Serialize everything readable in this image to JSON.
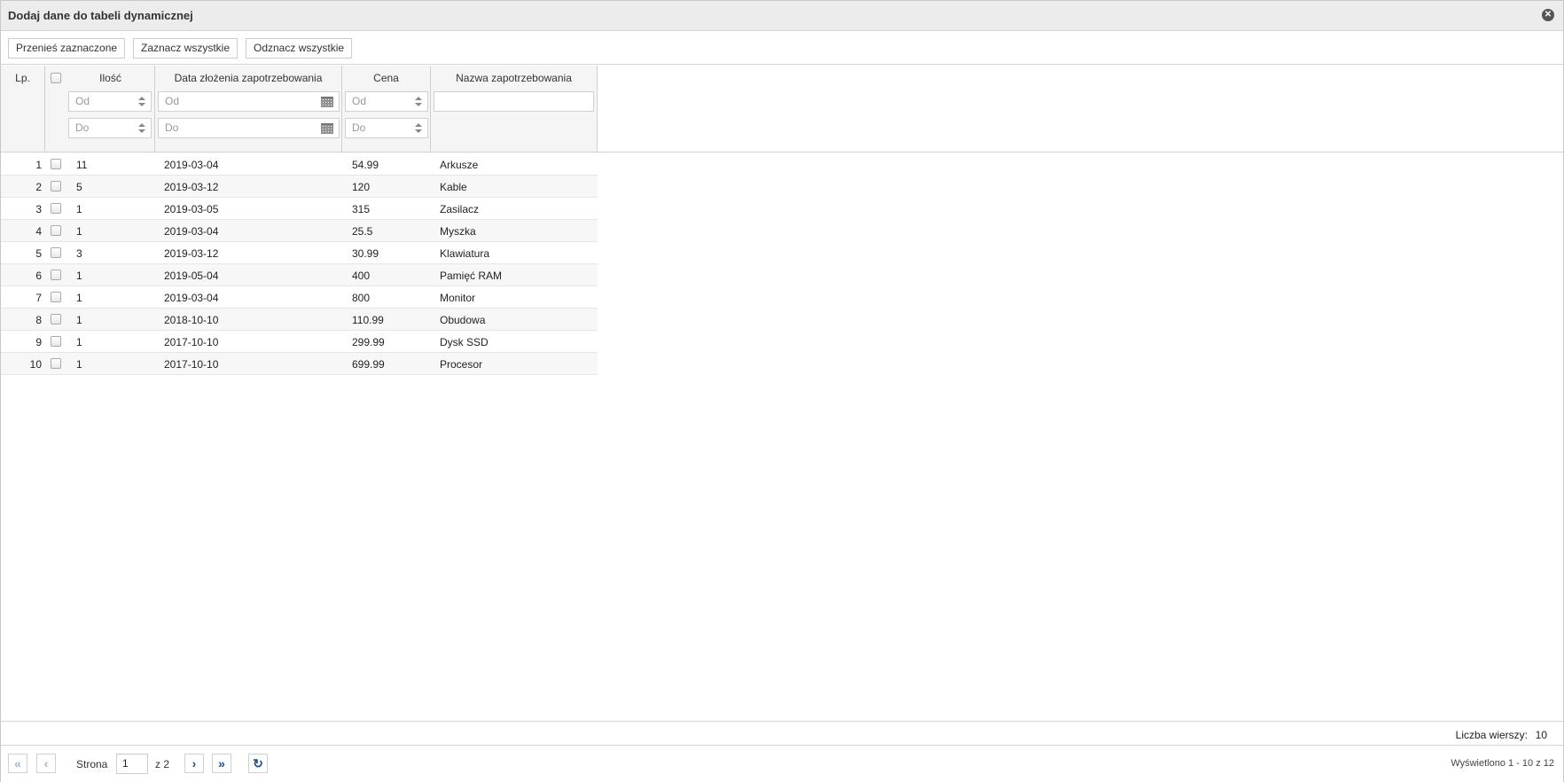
{
  "dialog": {
    "title": "Dodaj dane do tabeli dynamicznej",
    "close_icon": "close-circle-icon"
  },
  "toolbar": {
    "move_selected": "Przenieś zaznaczone",
    "select_all": "Zaznacz wszystkie",
    "deselect_all": "Odznacz wszystkie"
  },
  "columns": {
    "lp": "Lp.",
    "qty": "Ilość",
    "date": "Data złożenia zapotrzebowania",
    "price": "Cena",
    "name": "Nazwa zapotrzebowania"
  },
  "filters": {
    "qty_from": "Od",
    "qty_to": "Do",
    "date_from": "Od",
    "date_to": "Do",
    "price_from": "Od",
    "price_to": "Do",
    "name": ""
  },
  "rows": [
    {
      "lp": "1",
      "qty": "11",
      "date": "2019-03-04",
      "price": "54.99",
      "name": "Arkusze"
    },
    {
      "lp": "2",
      "qty": "5",
      "date": "2019-03-12",
      "price": "120",
      "name": "Kable"
    },
    {
      "lp": "3",
      "qty": "1",
      "date": "2019-03-05",
      "price": "315",
      "name": "Zasilacz"
    },
    {
      "lp": "4",
      "qty": "1",
      "date": "2019-03-04",
      "price": "25.5",
      "name": "Myszka"
    },
    {
      "lp": "5",
      "qty": "3",
      "date": "2019-03-12",
      "price": "30.99",
      "name": "Klawiatura"
    },
    {
      "lp": "6",
      "qty": "1",
      "date": "2019-05-04",
      "price": "400",
      "name": "Pamięć RAM"
    },
    {
      "lp": "7",
      "qty": "1",
      "date": "2019-03-04",
      "price": "800",
      "name": "Monitor"
    },
    {
      "lp": "8",
      "qty": "1",
      "date": "2018-10-10",
      "price": "110.99",
      "name": "Obudowa"
    },
    {
      "lp": "9",
      "qty": "1",
      "date": "2017-10-10",
      "price": "299.99",
      "name": "Dysk SSD"
    },
    {
      "lp": "10",
      "qty": "1",
      "date": "2017-10-10",
      "price": "699.99",
      "name": "Procesor"
    }
  ],
  "footer": {
    "rows_label": "Liczba wierszy:",
    "rows_value": "10"
  },
  "pager": {
    "page_label": "Strona",
    "page_value": "1",
    "of_label": "z 2",
    "displayed": "Wyświetlono 1 - 10 z 12",
    "icons": [
      "first-page-icon",
      "prev-page-icon",
      "next-page-icon",
      "last-page-icon",
      "refresh-icon"
    ]
  }
}
